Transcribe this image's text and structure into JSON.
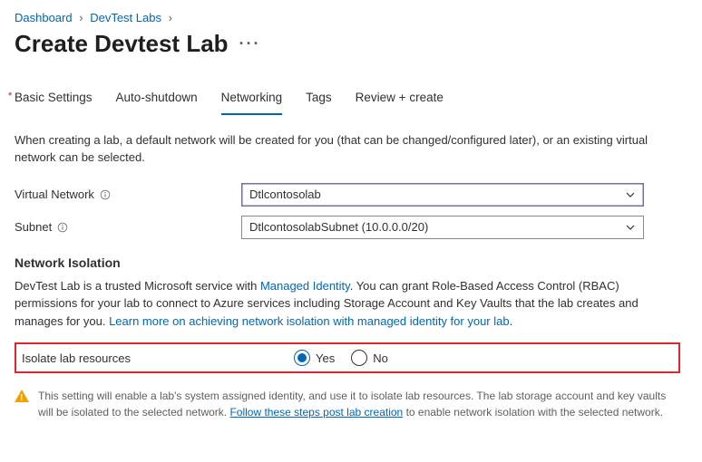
{
  "breadcrumb": {
    "items": [
      "Dashboard",
      "DevTest Labs"
    ]
  },
  "page_title": "Create Devtest Lab",
  "tabs": {
    "basic": "Basic Settings",
    "auto": "Auto-shutdown",
    "net": "Networking",
    "tags": "Tags",
    "review": "Review + create"
  },
  "description": "When creating a lab, a default network will be created for you (that can be changed/configured later), or an existing virtual network can be selected.",
  "fields": {
    "vnet_label": "Virtual Network",
    "vnet_value": "Dtlcontosolab",
    "subnet_label": "Subnet",
    "subnet_value": "DtlcontosolabSubnet (10.0.0.0/20)"
  },
  "isolation": {
    "heading": "Network Isolation",
    "text_pre": "DevTest Lab is a trusted Microsoft service with ",
    "link1": "Managed Identity",
    "text_mid": ". You can grant Role-Based Access Control (RBAC) permissions for your lab to connect to Azure services including Storage Account and Key Vaults that the lab creates and manages for you. ",
    "link2": "Learn more on achieving network isolation with managed identity for your lab",
    "isolate_label": "Isolate lab resources",
    "yes": "Yes",
    "no": "No"
  },
  "alert": {
    "text_pre": "This setting will enable a lab's system assigned identity, and use it to isolate lab resources. The lab storage account and key vaults will be isolated to the selected network. ",
    "link": "Follow these steps post lab creation",
    "text_post": " to enable network isolation with the selected network."
  }
}
